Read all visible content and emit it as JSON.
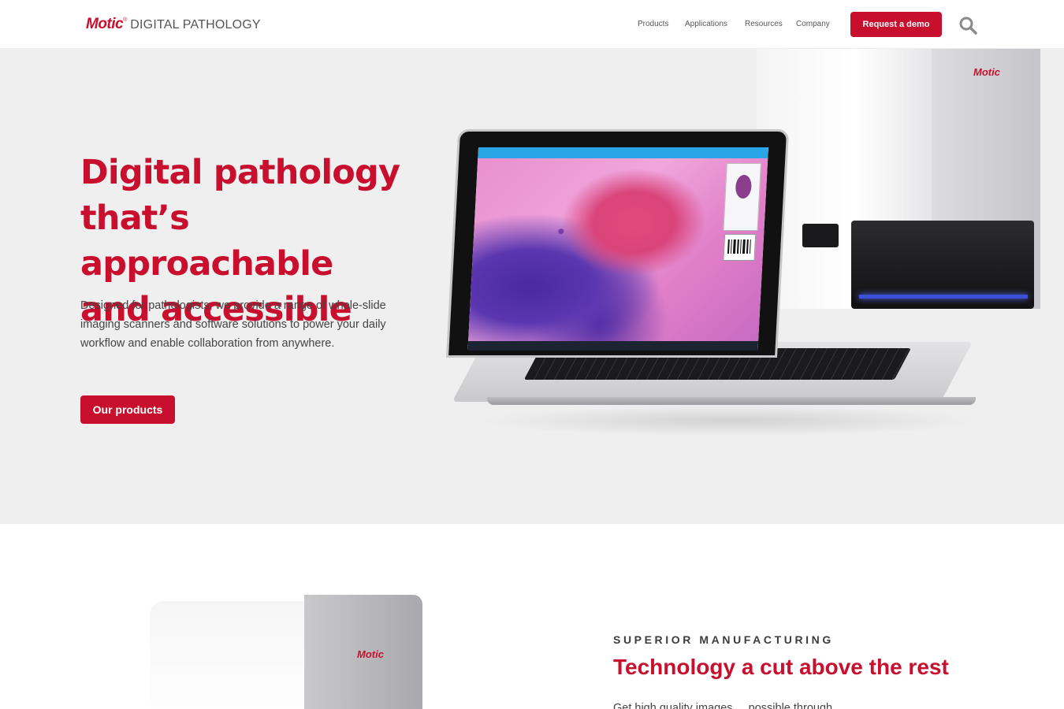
{
  "header": {
    "logo_brand": "Motic",
    "logo_reg": "®",
    "logo_sub": "DIGITAL PATHOLOGY",
    "nav": [
      "Products",
      "Applications",
      "Resources",
      "Company"
    ],
    "demo_label": "Request a demo",
    "search_icon": "search-icon"
  },
  "hero": {
    "title_lines": [
      "Digital pathology",
      "that’s approachable",
      "and accessible"
    ],
    "description": "Designed for pathologists, we provide a range of whole-slide imaging scanners and software solutions to power your daily workflow and enable collaboration from anywhere.",
    "cta_label": "Our products",
    "scanner_brand": "Motic"
  },
  "section2": {
    "eyebrow": "SUPERIOR MANUFACTURING",
    "title": "Technology a cut above the rest",
    "body_partial": "Get high quality images ... possible through ...",
    "scanner_brand": "Motic"
  },
  "colors": {
    "brand_red": "#c8102e",
    "hero_bg": "#efeff0"
  }
}
